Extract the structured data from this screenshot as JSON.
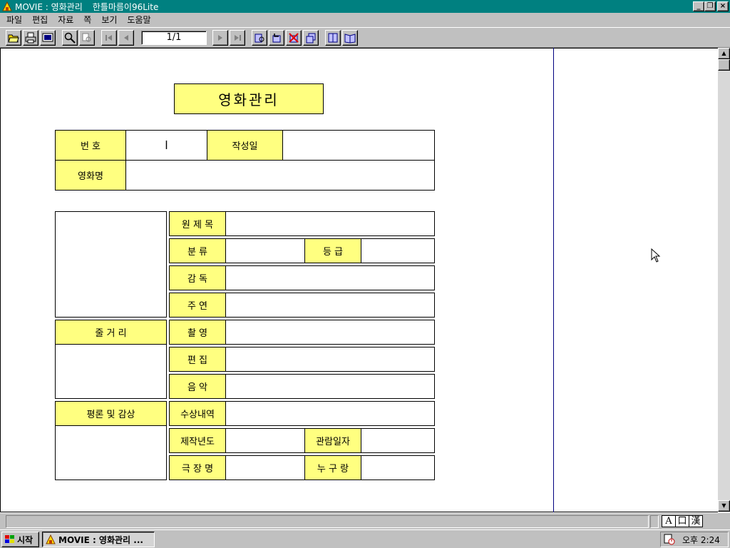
{
  "window": {
    "title_app": "MOVIE : 영화관리",
    "title_program": "한틀마름이96Lite",
    "controls": [
      "_",
      "❐",
      "×"
    ]
  },
  "menu": [
    "파일",
    "편집",
    "자료",
    "쪽",
    "보기",
    "도움말"
  ],
  "toolbar": {
    "page_indicator": "1/1",
    "icons": [
      "open-icon",
      "print-icon",
      "preview-icon",
      "search-icon",
      "find-replace-icon",
      "first-page-icon",
      "prev-page-icon",
      "next-page-icon",
      "last-page-icon",
      "add-record-icon",
      "insert-record-icon",
      "delete-record-icon",
      "copy-record-icon",
      "book-icon",
      "book-open-icon"
    ]
  },
  "form": {
    "title": "영화관리",
    "fields": {
      "number_label": "번  호",
      "number_value": "l",
      "date_label": "작성일",
      "movie_name_label": "영화명",
      "original_title_label": "원 제 목",
      "category_label": "분    류",
      "rating_label": "등  급",
      "director_label": "감    독",
      "cast_label": "주    연",
      "cinematography_label": "촬    영",
      "editing_label": "편    집",
      "music_label": "음    악",
      "synopsis_label": "줄 거 리",
      "review_label": "평론 및 감상",
      "awards_label": "수상내역",
      "production_year_label": "제작년도",
      "viewing_date_label": "관람일자",
      "theater_label": "극 장 명",
      "companion_label": "누 구 랑"
    }
  },
  "statusbar": {
    "ime_modes": [
      "A",
      "口",
      "漢"
    ]
  },
  "taskbar": {
    "start_label": "시작",
    "task_label": "MOVIE : 영화관리 ...",
    "clock": "오후 2:24"
  }
}
